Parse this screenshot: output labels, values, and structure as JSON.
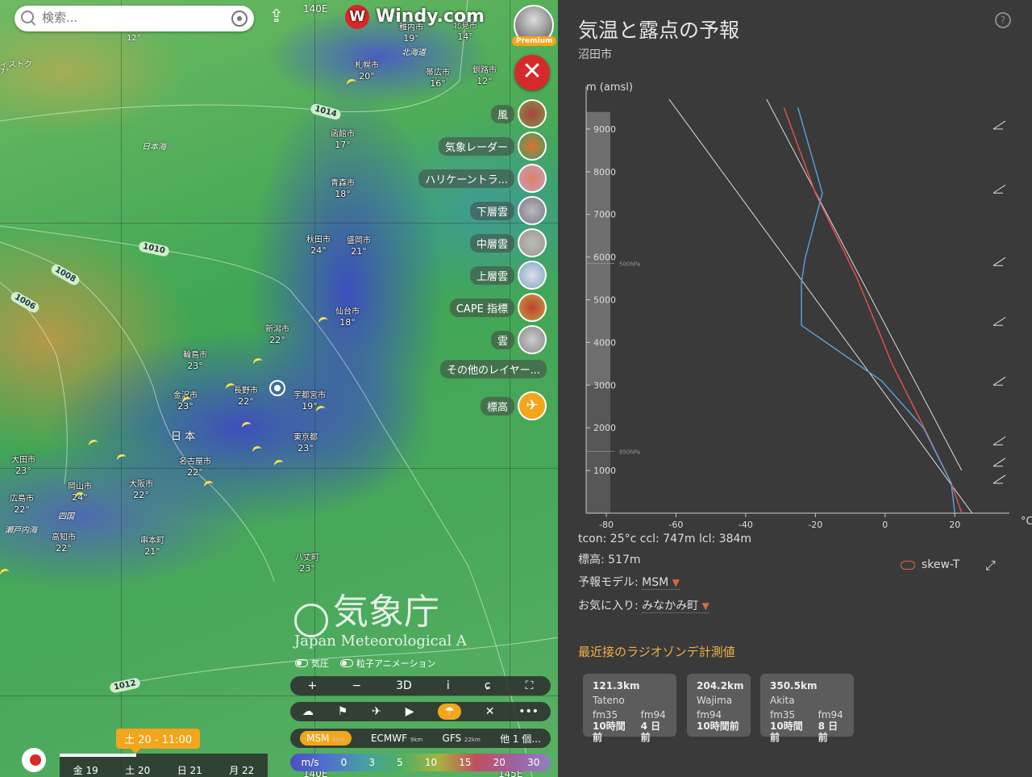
{
  "map": {
    "search_placeholder": "検索...",
    "logo_text": "Windy.com",
    "premium_label": "Premium",
    "close_label": "✕",
    "grid_labels": {
      "lon_top": "140E",
      "lon_bottom_1": "140E",
      "lon_bottom_2": "145E"
    },
    "regions": [
      "日本海",
      "日 本",
      "北海道",
      "四国",
      "瀬戸内海"
    ],
    "cities": [
      {
        "name": "稚内市",
        "temp": "19°"
      },
      {
        "name": "北見市",
        "temp": "14°"
      },
      {
        "name": "札幌市",
        "temp": "20°"
      },
      {
        "name": "帯広市",
        "temp": "16°"
      },
      {
        "name": "釧路市",
        "temp": "12°"
      },
      {
        "name": "函館市",
        "temp": "17°"
      },
      {
        "name": "青森市",
        "temp": "18°"
      },
      {
        "name": "秋田市",
        "temp": "24°"
      },
      {
        "name": "盛岡市",
        "temp": "21°"
      },
      {
        "name": "仙台市",
        "temp": "18°"
      },
      {
        "name": "新潟市",
        "temp": "22°"
      },
      {
        "name": "輪島市",
        "temp": "23°"
      },
      {
        "name": "長野市",
        "temp": "22°"
      },
      {
        "name": "金沢市",
        "temp": "23°"
      },
      {
        "name": "宇都宮市",
        "temp": "19°"
      },
      {
        "name": "東京都",
        "temp": "23°"
      },
      {
        "name": "名古屋市",
        "temp": "22°"
      },
      {
        "name": "大阪市",
        "temp": "22°"
      },
      {
        "name": "岡山市",
        "temp": "24°"
      },
      {
        "name": "広島市",
        "temp": "22°"
      },
      {
        "name": "大田市",
        "temp": "23°"
      },
      {
        "name": "高知市",
        "temp": "22°"
      },
      {
        "name": "串本町",
        "temp": "21°"
      },
      {
        "name": "八丈町",
        "temp": "23°"
      }
    ],
    "small_labels": {
      "left_edge": "ィストク",
      "left_temp": "7°",
      "top_temp": "12°"
    },
    "pressures": [
      "1014",
      "1010",
      "1008",
      "1006",
      "1012"
    ],
    "layers": [
      {
        "label": "風",
        "icon": "wind-icon"
      },
      {
        "label": "気象レーダー",
        "icon": "radar-icon"
      },
      {
        "label": "ハリケーントラ...",
        "icon": "hurricane-icon"
      },
      {
        "label": "下層雲",
        "icon": "low-cloud-icon"
      },
      {
        "label": "中層雲",
        "icon": "mid-cloud-icon"
      },
      {
        "label": "上層雲",
        "icon": "high-cloud-icon"
      },
      {
        "label": "CAPE 指標",
        "icon": "cape-icon"
      },
      {
        "label": "雲",
        "icon": "cloud-icon"
      }
    ],
    "more_layers": "その他のレイヤー...",
    "altitude_label": "標高",
    "jma_logo": "気象庁",
    "jma_logo_en": "Japan Meteorological A",
    "toggles": {
      "pressure": "気圧",
      "particles": "粒子アニメーション"
    },
    "toolbar1": {
      "plus": "+",
      "minus": "−",
      "three_d": "3D",
      "info": "i",
      "hurricane": "ɕ",
      "fullscreen": "⛶"
    },
    "toolbar2": {
      "weather": "☁",
      "flag": "⚑",
      "plane": "✈",
      "camera": "▶",
      "paraglide": "☂",
      "tools": "✕",
      "more": "•••"
    },
    "models": [
      {
        "name": "MSM",
        "res": "5km",
        "selected": true
      },
      {
        "name": "ECMWF",
        "res": "9km",
        "selected": false
      },
      {
        "name": "GFS",
        "res": "22km",
        "selected": false
      },
      {
        "name": "他 1 個...",
        "res": "",
        "selected": false
      }
    ],
    "legend": {
      "unit": "m/s",
      "values": [
        "0",
        "3",
        "5",
        "10",
        "15",
        "20",
        "30"
      ]
    },
    "time_bubble": "土 20 - 11:00",
    "days": [
      "金 19",
      "土 20",
      "日 21",
      "月 22"
    ],
    "timeline_progress": 0.37
  },
  "panel": {
    "title": "気温と露点の予報",
    "location": "沼田市",
    "help": "?",
    "info_line": "tcon: 25°c ccl: 747m lcl: 384m",
    "elevation": "標高: 517m",
    "model_label": "予報モデル:",
    "model_value": "MSM",
    "favorite_label": "お気に入り:",
    "favorite_value": "みなかみ町",
    "skewt_label": "skew-T",
    "radiosonde_title": "最近接のラジオゾンデ計測値",
    "stations": [
      {
        "distance": "121.3km",
        "name": "Tateno",
        "c1h": "fm35",
        "c1v": "10時間前",
        "c2h": "fm94",
        "c2v": "4 日前"
      },
      {
        "distance": "204.2km",
        "name": "Wajima",
        "c1h": "fm94",
        "c1v": "10時間前"
      },
      {
        "distance": "350.5km",
        "name": "Akita",
        "c1h": "fm35",
        "c1v": "10時間前",
        "c2h": "fm94",
        "c2v": "8 日前"
      }
    ]
  },
  "chart_data": {
    "type": "line",
    "title": "",
    "ylabel": "m (amsl)",
    "xlabel": "°C",
    "xlim": [
      -80,
      38
    ],
    "ylim": [
      0,
      10000
    ],
    "x_ticks": [
      -80,
      -60,
      -40,
      -20,
      0,
      20
    ],
    "y_ticks": [
      1000,
      2000,
      3000,
      4000,
      5000,
      6000,
      7000,
      8000,
      9000
    ],
    "pressure_labels": [
      {
        "label": "500hPa",
        "alt": 5850
      },
      {
        "label": "850hPa",
        "alt": 1450
      }
    ],
    "series": [
      {
        "color": "#e05050",
        "points": [
          [
            22,
            0
          ],
          [
            19,
            700
          ],
          [
            10,
            2200
          ],
          [
            2,
            3500
          ],
          [
            -3,
            4500
          ],
          [
            -8,
            5500
          ],
          [
            -14,
            6500
          ],
          [
            -20,
            7500
          ],
          [
            -29,
            9500
          ]
        ]
      },
      {
        "color": "#5b9bd5",
        "points": [
          [
            20,
            0
          ],
          [
            19,
            700
          ],
          [
            11,
            2000
          ],
          [
            -1,
            3100
          ],
          [
            -24,
            4400
          ],
          [
            -24,
            5400
          ],
          [
            -23,
            5950
          ],
          [
            -18,
            7500
          ],
          [
            -25,
            9500
          ]
        ]
      }
    ],
    "reference_lines": [
      {
        "color": "#dcdcdc",
        "points": [
          [
            25,
            0
          ],
          [
            -62,
            9700
          ]
        ]
      },
      {
        "color": "#dcdcdc",
        "points": [
          [
            22,
            1000
          ],
          [
            -34,
            9700
          ]
        ]
      }
    ]
  }
}
